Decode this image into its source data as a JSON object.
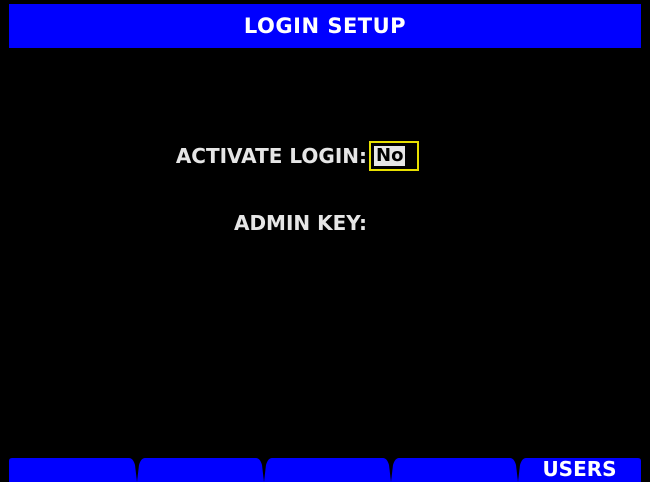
{
  "header": {
    "title": "LOGIN SETUP"
  },
  "fields": {
    "activate_login": {
      "label": "ACTIVATE LOGIN:",
      "value": "No"
    },
    "admin_key": {
      "label": "ADMIN KEY:",
      "value": ""
    }
  },
  "softkeys": [
    {
      "label": ""
    },
    {
      "label": ""
    },
    {
      "label": ""
    },
    {
      "label": ""
    },
    {
      "label": "USERS"
    }
  ],
  "colors": {
    "background": "#000000",
    "title_bar": "#0000ff",
    "softkey": "#0000ff",
    "focus_border": "#e8e000",
    "text": "#e6e6e6"
  }
}
